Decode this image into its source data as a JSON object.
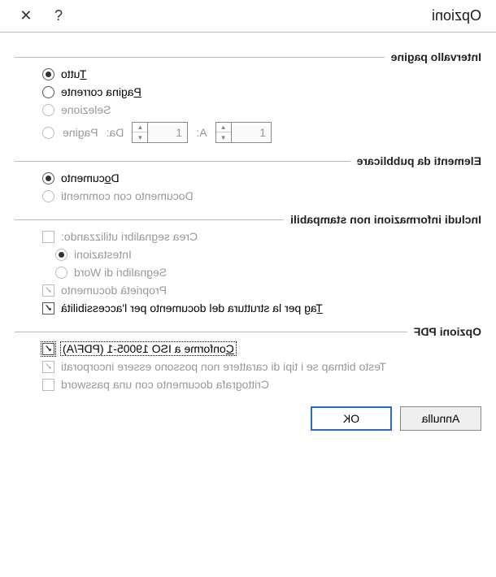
{
  "title": "Opzioni",
  "help_icon": "?",
  "close_icon": "✕",
  "sections": {
    "range": {
      "title": "Intervallo pagine",
      "all": "Tutto",
      "current": "Pagina corrente",
      "selection": "Selezione",
      "pages": "Pagine",
      "from_label": "Da:",
      "to_label": "A:",
      "from_value": "1",
      "to_value": "1"
    },
    "publish": {
      "title": "Elementi da pubblicare",
      "document": "Documento",
      "with_comments": "Documento con commenti"
    },
    "nonprint": {
      "title": "Includi informazioni non stampabili",
      "bookmarks": "Crea segnalibri utilizzando:",
      "headings": "Intestazioni",
      "word_bm": "Segnalibri di Word",
      "docprops": "Proprietà documento",
      "tags": "Tag per la struttura del documento per l'accessibilità"
    },
    "pdf": {
      "title": "Opzioni PDF",
      "isoconf": "Conforme a ISO 19005-1 (PDF/A)",
      "bitmap": "Testo bitmap se i tipi di carattere non possono essere incorporati",
      "encrypt": "Crittografa documento con una password"
    }
  },
  "buttons": {
    "ok": "OK",
    "cancel": "Annulla"
  }
}
